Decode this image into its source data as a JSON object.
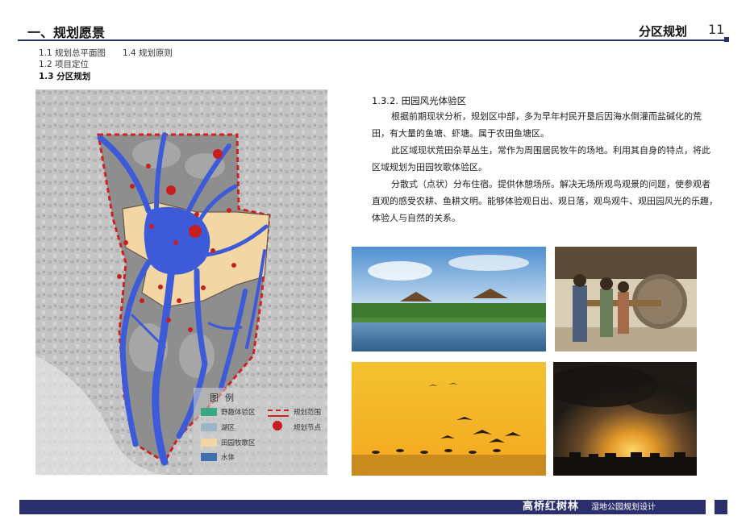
{
  "header": {
    "section_title": "一、规划愿景",
    "page_label": "分区规划",
    "page_number": "11"
  },
  "nav": {
    "row1": [
      {
        "label": "1.1  规划总平面图"
      },
      {
        "label": "1.4  规划原则"
      }
    ],
    "item_12": "1.2  项目定位",
    "item_13": "1.3  分区规划"
  },
  "legend": {
    "title": "图例",
    "items": [
      {
        "label": "野趣体验区",
        "color": "#3aa882"
      },
      {
        "label": "湖区",
        "color": "#9bb6c6"
      },
      {
        "label": "田园牧歌区",
        "color": "#f2d7a4"
      },
      {
        "label": "水体",
        "color": "#3f6fae"
      },
      {
        "label": "规划范围",
        "color": "#cc2222"
      },
      {
        "label": "规划节点",
        "color": "#c81e1e"
      }
    ]
  },
  "content": {
    "heading": "1.3.2. 田园风光体验区",
    "paragraphs": [
      "根据前期现状分析，规划区中部，多为早年村民开垦后因海水倒灌而盐碱化的荒田，有大量的鱼塘、虾塘。属于农田鱼塘区。",
      "此区域现状荒田杂草丛生，常作为周围居民牧牛的场地。利用其自身的特点，将此区域规划为田园牧歌体验区。",
      "分散式（点状）分布住宿。提供休憩场所。解决无场所观鸟观景的问题，使参观者直观的感受农耕、鱼耕文明。能够体验观日出、观日落，观鸟观牛、观田园风光的乐趣，体验人与自然的关系。"
    ]
  },
  "colors": {
    "brand_navy": "#2c2f6e",
    "water_blue": "#3d5bd9",
    "pastoral_zone": "#f2d7a4",
    "boundary_red": "#cc2222"
  },
  "footer": {
    "brand": "高桥红树林",
    "subtitle": "湿地公园规划设计"
  }
}
